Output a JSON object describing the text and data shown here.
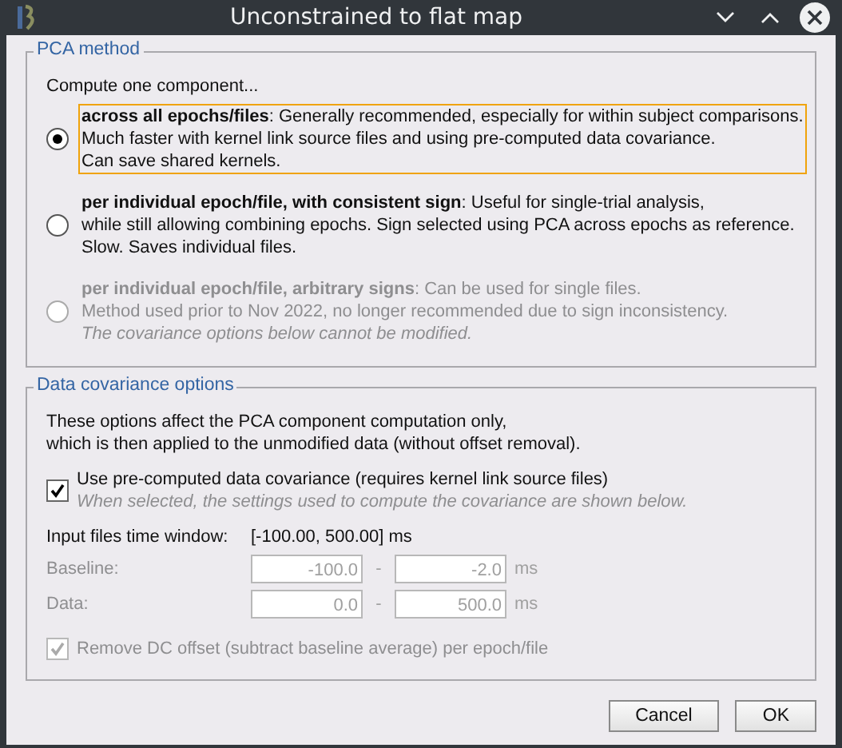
{
  "window": {
    "title": "Unconstrained to flat map"
  },
  "pca_method": {
    "legend": "PCA method",
    "intro": "Compute one component...",
    "options": [
      {
        "lines": [
          "**across all epochs/files**: Generally recommended, especially for within subject comparisons.",
          "Much faster with kernel link source files and using pre-computed data covariance.",
          "Can save shared kernels."
        ],
        "selected": true,
        "focused": true,
        "disabled": false
      },
      {
        "lines": [
          "**per individual epoch/file, with consistent sign**: Useful for single-trial analysis,",
          "while still allowing combining epochs. Sign selected using PCA across epochs as reference.",
          "Slow. Saves individual files."
        ],
        "selected": false,
        "focused": false,
        "disabled": false
      },
      {
        "lines": [
          "**per individual epoch/file, arbitrary signs**: Can be used for single files.",
          "Method used prior to Nov 2022, no longer recommended due to sign inconsistency."
        ],
        "note": "The covariance options below cannot be modified.",
        "selected": false,
        "focused": false,
        "disabled": true
      }
    ]
  },
  "covariance": {
    "legend": "Data covariance options",
    "description": [
      "These options affect the PCA component computation only,",
      "which is then applied to the unmodified data (without offset removal)."
    ],
    "use_precomputed": {
      "label": "Use pre-computed data covariance (requires kernel link source files)",
      "hint": "When selected, the settings used to compute the covariance are shown below.",
      "checked": true,
      "disabled": false
    },
    "time_window": {
      "label": "Input files time window:",
      "value": "[-100.00, 500.00] ms"
    },
    "ranges": [
      {
        "label": "Baseline:",
        "from": "-100.0",
        "separator": "-",
        "to": "-2.0",
        "unit": "ms",
        "disabled": true
      },
      {
        "label": "Data:",
        "from": "0.0",
        "separator": "-",
        "to": "500.0",
        "unit": "ms",
        "disabled": true
      }
    ],
    "remove_dc": {
      "label": "Remove DC offset (subtract baseline average) per epoch/file",
      "checked": true,
      "disabled": true
    }
  },
  "buttons": [
    "Cancel",
    "OK"
  ]
}
